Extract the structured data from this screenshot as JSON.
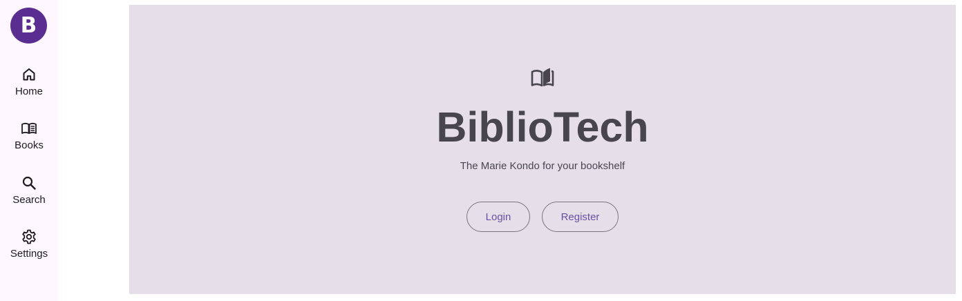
{
  "rail": {
    "logo_letter": "B",
    "items": [
      {
        "label": "Home",
        "icon": "home-icon"
      },
      {
        "label": "Books",
        "icon": "book-icon"
      },
      {
        "label": "Search",
        "icon": "search-icon"
      },
      {
        "label": "Settings",
        "icon": "gear-icon"
      }
    ]
  },
  "hero": {
    "icon": "open-book-icon",
    "title": "BiblioTech",
    "tagline": "The Marie Kondo for your bookshelf",
    "login_label": "Login",
    "register_label": "Register"
  },
  "colors": {
    "brand": "#5a2e91",
    "hero_background": "#e6dfea",
    "rail_background": "#fef7ff",
    "button_text": "#6750a4",
    "button_outline": "#79747e"
  }
}
